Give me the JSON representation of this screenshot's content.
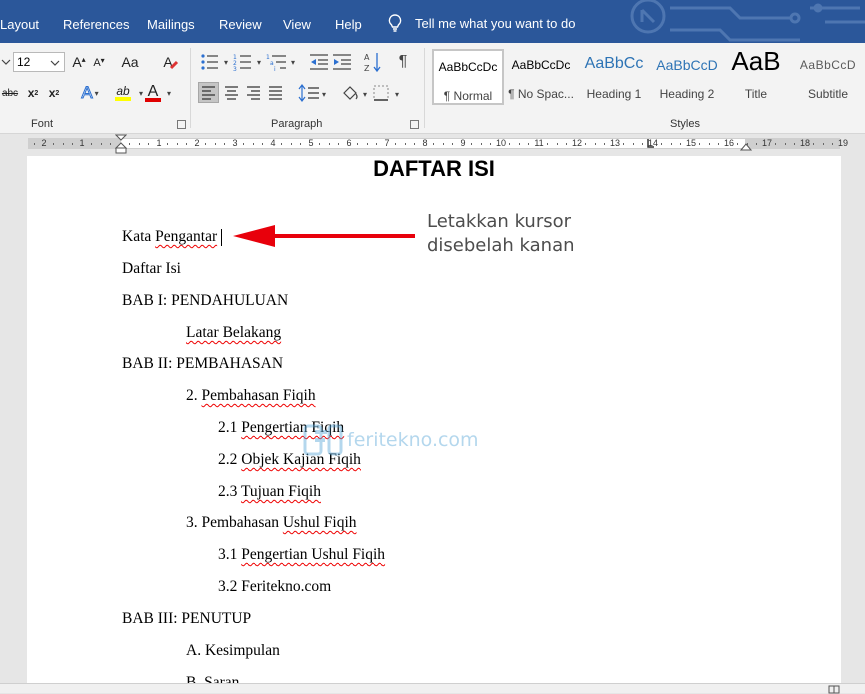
{
  "ribbon_tabs": [
    "Layout",
    "References",
    "Mailings",
    "Review",
    "View",
    "Help"
  ],
  "tell_me": "Tell me what you want to do",
  "font": {
    "size": "12",
    "group_label": "Font",
    "grow_label": "A",
    "shrink_label": "A",
    "clear_label": "A",
    "strike_label": "abc",
    "sub_label": "x",
    "sub_mark": "2",
    "sup_label": "x",
    "sup_mark": "2",
    "effects_label": "A",
    "highlight_label": "ab",
    "color_label": "A",
    "highlight_color": "#ffff00",
    "font_color": "#e00000"
  },
  "paragraph": {
    "group_label": "Paragraph"
  },
  "styles": {
    "group_label": "Styles",
    "items": [
      {
        "preview": "AaBbCcDc",
        "name": "¶ Normal"
      },
      {
        "preview": "AaBbCcDc",
        "name": "¶ No Spac..."
      },
      {
        "preview": "AaBbCc",
        "name": "Heading 1"
      },
      {
        "preview": "AaBbCcD",
        "name": "Heading 2"
      },
      {
        "preview": "AaB",
        "name": "Title"
      },
      {
        "preview": "AaBbCcD",
        "name": "Subtitle"
      }
    ]
  },
  "ruler_numbers": [
    "2",
    "1",
    "1",
    "2",
    "3",
    "4",
    "5",
    "6",
    "7",
    "8",
    "9",
    "10",
    "11",
    "12",
    "13",
    "14",
    "15",
    "16",
    "17",
    "18",
    "19"
  ],
  "document": {
    "title": "DAFTAR ISI",
    "annotation": [
      "Letakkan kursor",
      "disebelah kanan"
    ],
    "arrow_color": "#e8000b",
    "watermark": "feritekno.com",
    "lines": [
      {
        "prefix": "Kata ",
        "text": "Pengantar"
      },
      {
        "prefix": "",
        "text": "Daftar Isi"
      },
      {
        "prefix": "",
        "text": "BAB I: PENDAHULUAN"
      },
      {
        "prefix": "",
        "text": "Latar Belakang"
      },
      {
        "prefix": "",
        "text": "BAB II: PEMBAHASAN"
      },
      {
        "prefix": "2. ",
        "text": "Pembahasan Fiqih"
      },
      {
        "prefix": "2.1 ",
        "text": "Pengertian Fiqih"
      },
      {
        "prefix": "2.2 ",
        "text": "Objek Kajian Fiqih"
      },
      {
        "prefix": "2.3 ",
        "text": "Tujuan Fiqih"
      },
      {
        "prefix": "3. Pembahasan ",
        "text": "Ushul Fiqih"
      },
      {
        "prefix": "3.1 ",
        "text": "Pengertian Ushul Fiqih"
      },
      {
        "prefix": "3.2 ",
        "text": "Feritekno.com"
      },
      {
        "prefix": "",
        "text": "BAB III: PENUTUP"
      },
      {
        "prefix": "A. ",
        "text": "Kesimpulan"
      },
      {
        "prefix": "B. ",
        "text": "Saran"
      }
    ]
  }
}
